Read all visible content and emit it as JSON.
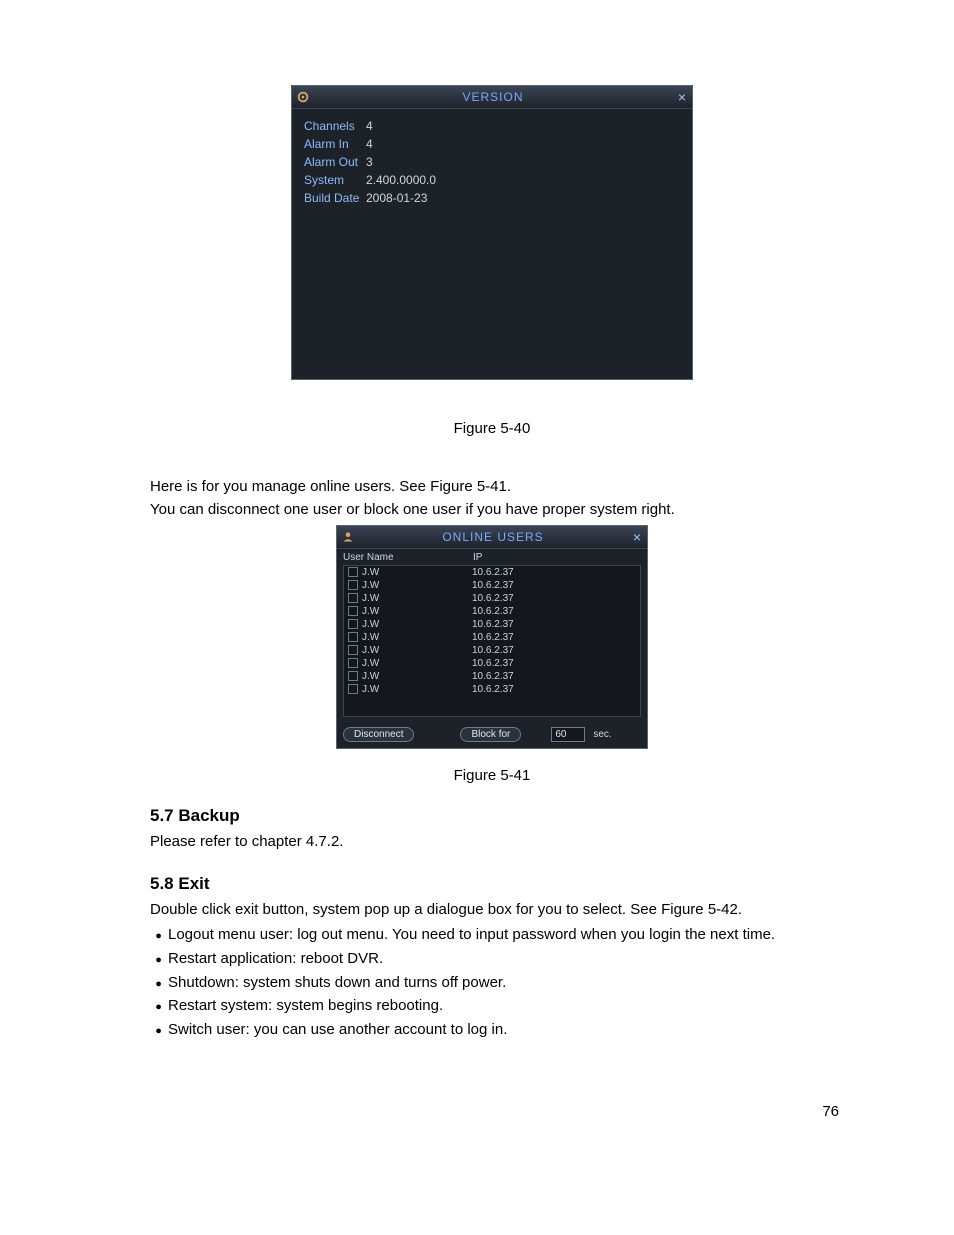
{
  "version_dialog": {
    "title": "VERSION",
    "rows": [
      {
        "label": "Channels",
        "value": "4"
      },
      {
        "label": "Alarm In",
        "value": "4"
      },
      {
        "label": "Alarm Out",
        "value": "3"
      },
      {
        "label": "System",
        "value": "2.400.0000.0"
      },
      {
        "label": "Build Date",
        "value": "2008-01-23"
      }
    ]
  },
  "fig540_caption": "Figure 5-40",
  "para_online_1": "Here is for you manage online users. See Figure 5-41.",
  "para_online_2": "You can disconnect one user or block one user if you have proper system right.",
  "online_dialog": {
    "title": "ONLINE USERS",
    "col_user": "User Name",
    "col_ip": "IP",
    "rows": [
      {
        "name": "J.W",
        "ip": "10.6.2.37"
      },
      {
        "name": "J.W",
        "ip": "10.6.2.37"
      },
      {
        "name": "J.W",
        "ip": "10.6.2.37"
      },
      {
        "name": "J.W",
        "ip": "10.6.2.37"
      },
      {
        "name": "J.W",
        "ip": "10.6.2.37"
      },
      {
        "name": "J.W",
        "ip": "10.6.2.37"
      },
      {
        "name": "J.W",
        "ip": "10.6.2.37"
      },
      {
        "name": "J.W",
        "ip": "10.6.2.37"
      },
      {
        "name": "J.W",
        "ip": "10.6.2.37"
      },
      {
        "name": "J.W",
        "ip": "10.6.2.37"
      }
    ],
    "disconnect_label": "Disconnect",
    "block_label": "Block for",
    "block_value": "60",
    "sec_label": "sec."
  },
  "fig541_caption": "Figure 5-41",
  "sec_backup_heading": "5.7  Backup",
  "sec_backup_text": "Please refer to chapter 4.7.2.",
  "sec_exit_heading": "5.8  Exit",
  "sec_exit_text": "Double click exit button, system pop up a dialogue box for you to select. See Figure 5-42.",
  "exit_bullets": [
    "Logout menu user: log out menu. You need to input password when you login the next time.",
    "Restart application: reboot DVR.",
    "Shutdown: system shuts down and turns off power.",
    " Restart system: system begins rebooting.",
    "Switch user: you can use another account to log in."
  ],
  "page_number": "76"
}
